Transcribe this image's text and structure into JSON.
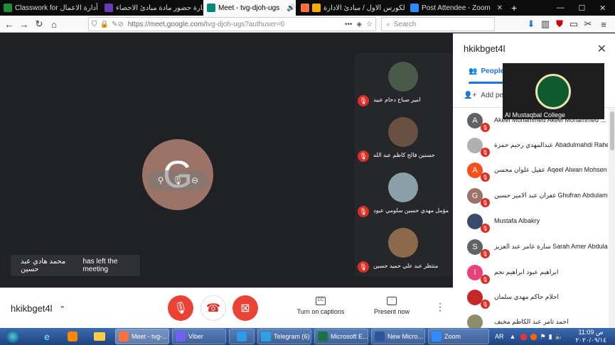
{
  "browser": {
    "tabs": [
      {
        "label": "Classwork for قسم أدارة الاعمال",
        "color": "#1e8e3e"
      },
      {
        "label": "استمارة حضور مادة مبادئ الاحصاء",
        "color": "#673ab7"
      },
      {
        "label": "Meet - tvg-djoh-ugs",
        "color": "#00897b",
        "active": true
      },
      {
        "label": "تقرير الكورس الاول / مبادئ الادارة",
        "color": "#f9ab00"
      },
      {
        "label": "Post Attendee - Zoom",
        "color": "#2d8cff"
      }
    ],
    "url_prefix": "https://meet.google.com/",
    "url_path": "tvg-djoh-ugs?authuser=0",
    "search_placeholder": "Search"
  },
  "meet": {
    "main_avatar_letter": "G",
    "toast_name": "محمد هادي عبد حسين",
    "toast_text": "has left the meeting",
    "tiles": [
      {
        "name": "امير صباح دحام عبيد",
        "color": "#4a5a4a"
      },
      {
        "name": "حسنين فالح كاظم عبد الله",
        "color": "#6a5040"
      },
      {
        "name": "مؤمل مهدي حسين سلومي عبود",
        "color": "#8aa0a8"
      },
      {
        "name": "منتظر عبد علي حميد حسين",
        "color": "#8a6a4a"
      }
    ],
    "bottom": {
      "meeting_code": "hkikbget4l",
      "captions_label": "Turn on captions",
      "present_label": "Present now"
    }
  },
  "panel": {
    "title": "hkikbget4l",
    "tab_people": "People",
    "add_people": "Add people",
    "floating_name": "Al Mustaqbal College",
    "people": [
      {
        "name": "Akeel Mohammed Akeel Mohammed ...",
        "initial": "A",
        "color": "#5f6368"
      },
      {
        "name": "عبدالمهدي رحيم حمزة Abadulmahdi Rahee...",
        "initial": "",
        "color": "#b0b0b0"
      },
      {
        "name": "عقيل علوان محسن Aqeel Alwan Mohsen",
        "initial": "A",
        "color": "#f4511e"
      },
      {
        "name": "غفران عبد الامير حسين Ghufran Abdulameer",
        "initial": "G",
        "color": "#9b7367"
      },
      {
        "name": "Mustafa Albakry",
        "initial": "",
        "color": "#3c4a6a"
      },
      {
        "name": "سارة عامر عبد العزيز Sarah Amer Abdulaziz",
        "initial": "S",
        "color": "#5f6368"
      },
      {
        "name": "ابراهيم عبود ابراهيم نجم",
        "initial": "I",
        "color": "#ec407a"
      },
      {
        "name": "احلام حاكم مهدي سلمان",
        "initial": "",
        "color": "#c62828"
      },
      {
        "name": "احمد ثامر عبد الكاظم مخيف",
        "initial": "",
        "color": "#8d8d6a"
      }
    ]
  },
  "taskbar": {
    "tasks": [
      {
        "label": "Meet - tvg-...",
        "color": "#ff7139"
      },
      {
        "label": "Viber",
        "color": "#7360f2"
      },
      {
        "label": "",
        "color": "#2f9be8"
      },
      {
        "label": "Telegram (6)",
        "color": "#2aa3df"
      },
      {
        "label": "Microsoft E...",
        "color": "#1d7044"
      },
      {
        "label": "New Micro...",
        "color": "#2b579a"
      },
      {
        "label": "Zoom",
        "color": "#2d8cff"
      }
    ],
    "lang": "AR",
    "time": "11:09 ص",
    "date": "٢٠٢٠/٠٩/١٤"
  }
}
